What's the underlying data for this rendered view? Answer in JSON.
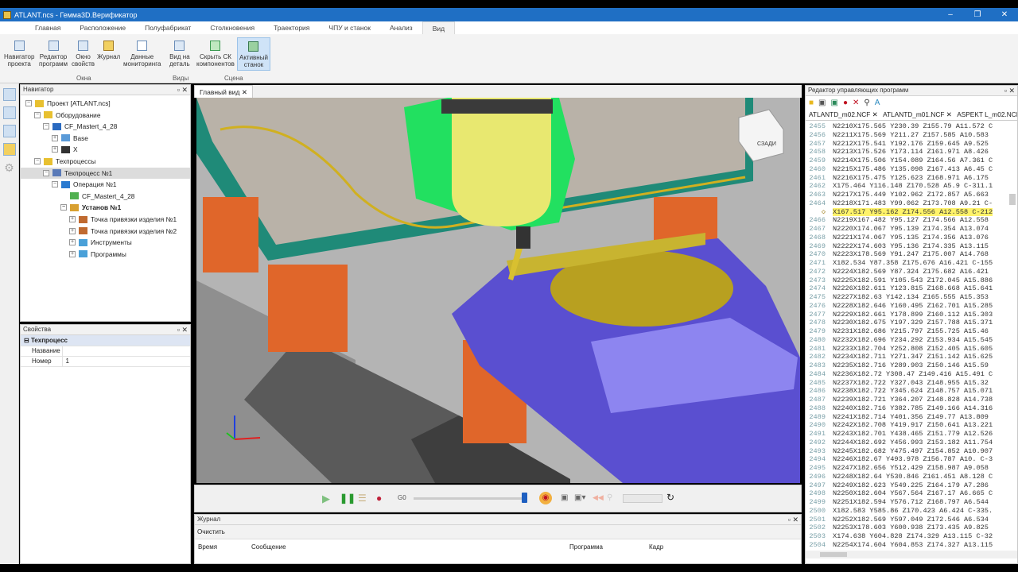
{
  "window": {
    "title": "ATLANT.ncs - Гемма3D.Верификатор",
    "controls": [
      "–",
      "❐",
      "✕"
    ]
  },
  "menu_tabs": [
    "Главная",
    "Расположение",
    "Полуфабрикат",
    "Столкновения",
    "Траектория",
    "ЧПУ и станок",
    "Анализ",
    "Вид"
  ],
  "ribbon": {
    "buttons": [
      {
        "l1": "Навигатор",
        "l2": "проекта"
      },
      {
        "l1": "Редактор",
        "l2": "программ"
      },
      {
        "l1": "Окно",
        "l2": "свойств"
      },
      {
        "l1": "Журнал",
        "l2": ""
      },
      {
        "l1": "Данные",
        "l2": "мониторинга"
      },
      {
        "l1": "Вид на",
        "l2": "деталь"
      },
      {
        "l1": "Скрыть СК",
        "l2": "компонентов"
      },
      {
        "l1": "Активный",
        "l2": "станок"
      }
    ],
    "groups": [
      "Окна",
      "Виды",
      "Сцена"
    ]
  },
  "navigator": {
    "title": "Навигатор",
    "items": [
      {
        "label": "Проект [ATLANT.ncs]",
        "level": 0,
        "exp": "−",
        "icon": "folder"
      },
      {
        "label": "Оборудование",
        "level": 1,
        "exp": "−",
        "icon": "folder"
      },
      {
        "label": "CF_Mastert_4_28",
        "level": 2,
        "exp": "−",
        "icon": "machine"
      },
      {
        "label": "Base",
        "level": 3,
        "exp": "+",
        "icon": "base"
      },
      {
        "label": "X",
        "level": 3,
        "exp": "+",
        "icon": "axis"
      },
      {
        "label": "Техпроцессы",
        "level": 1,
        "exp": "−",
        "icon": "folder"
      },
      {
        "label": "Техпроцесс №1",
        "level": 2,
        "exp": "−",
        "icon": "gears",
        "selected": true
      },
      {
        "label": "Операция №1",
        "level": 3,
        "exp": "−",
        "icon": "gear"
      },
      {
        "label": "CF_Mastert_4_28",
        "level": 4,
        "exp": "",
        "icon": "machine-green"
      },
      {
        "label": "Установ №1",
        "level": 4,
        "exp": "−",
        "icon": "setup",
        "bold": true
      },
      {
        "label": "Точка привязки изделия №1",
        "level": 5,
        "exp": "+",
        "icon": "point"
      },
      {
        "label": "Точка привязки изделия №2",
        "level": 5,
        "exp": "+",
        "icon": "point"
      },
      {
        "label": "Инструменты",
        "level": 5,
        "exp": "+",
        "icon": "bfolder"
      },
      {
        "label": "Программы",
        "level": 5,
        "exp": "+",
        "icon": "bfolder"
      }
    ]
  },
  "properties": {
    "title": "Свойства",
    "section": "Техпроцесс",
    "rows": [
      {
        "name": "Название",
        "value": ""
      },
      {
        "name": "Номер",
        "value": "1"
      }
    ]
  },
  "view": {
    "tab": "Главный вид",
    "cube_label": "СЗАДИ"
  },
  "player": {
    "progress": 1.0
  },
  "journal": {
    "title": "Журнал",
    "clear": "Очистить",
    "columns": [
      "Время",
      "Сообщение",
      "Программа",
      "Кадр"
    ]
  },
  "editor": {
    "title": "Редактор управляющих программ",
    "tabs": [
      "ATLANTD_m02.NCF",
      "ATLANTD_m01.NCF",
      "ASPEKT L_m02.NCF"
    ],
    "first_line": 2455,
    "highlight_index": 10,
    "lines": [
      "N2210X175.565 Y230.39 Z155.79 A11.572 C",
      "N2211X175.569 Y211.27 Z157.585 A10.583",
      "N2212X175.541 Y192.176 Z159.645 A9.525",
      "N2213X175.526 Y173.114 Z161.971 A8.426",
      "N2214X175.506 Y154.089 Z164.56 A7.361 C",
      "N2215X175.486 Y135.098 Z167.413 A6.45 C",
      "N2216X175.475 Y125.623 Z168.971 A6.175",
      "X175.464 Y116.148 Z170.528 A5.9 C-311.1",
      "N2217X175.449 Y102.962 Z172.857 A5.663",
      "N2218X171.483 Y99.062 Z173.708 A9.21 C-",
      "X167.517 Y95.162 Z174.556 A12.558 C-212",
      "N2219X167.482 Y95.127 Z174.566 A12.558",
      "N2220X174.067 Y95.139 Z174.354 A13.074",
      "N2221X174.067 Y95.135 Z174.356 A13.076",
      "N2222X174.603 Y95.136 Z174.335 A13.115",
      "N2223X178.569 Y91.247 Z175.007 A14.768",
      "X182.534 Y87.358 Z175.676 A16.421 C-155",
      "N2224X182.569 Y87.324 Z175.682 A16.421",
      "N2225X182.591 Y105.543 Z172.045 A15.886",
      "N2226X182.611 Y123.815 Z168.668 A15.641",
      "N2227X182.63 Y142.134 Z165.555 A15.353",
      "N2228X182.646 Y160.495 Z162.701 A15.285",
      "N2229X182.661 Y178.899 Z160.112 A15.303",
      "N2230X182.675 Y197.329 Z157.788 A15.371",
      "N2231X182.686 Y215.797 Z155.725 A15.46",
      "N2232X182.696 Y234.292 Z153.934 A15.545",
      "N2233X182.704 Y252.808 Z152.405 A15.605",
      "N2234X182.711 Y271.347 Z151.142 A15.625",
      "N2235X182.716 Y289.903 Z150.146 A15.59",
      "N2236X182.72 Y308.47 Z149.416 A15.491 C",
      "N2237X182.722 Y327.043 Z148.955 A15.32",
      "N2238X182.722 Y345.624 Z148.757 A15.071",
      "N2239X182.721 Y364.207 Z148.828 A14.738",
      "N2240X182.716 Y382.785 Z149.166 A14.316",
      "N2241X182.714 Y401.356 Z149.77 A13.809",
      "N2242X182.708 Y419.917 Z150.641 A13.221",
      "N2243X182.701 Y438.465 Z151.779 A12.526",
      "N2244X182.692 Y456.993 Z153.182 A11.754",
      "N2245X182.682 Y475.497 Z154.852 A10.907",
      "N2246X182.67 Y493.978 Z156.787 A10. C-3",
      "N2247X182.656 Y512.429 Z158.987 A9.058",
      "N2248X182.64 Y530.846 Z161.451 A8.128 C",
      "N2249X182.623 Y549.225 Z164.179 A7.286",
      "N2250X182.604 Y567.564 Z167.17 A6.665 C",
      "N2251X182.594 Y576.712 Z168.797 A6.544",
      "X182.583 Y585.86 Z170.423 A6.424 C-335.",
      "N2252X182.569 Y597.049 Z172.546 A6.534",
      "N2253X178.603 Y600.938 Z173.435 A9.825",
      "X174.638 Y604.828 Z174.329 A13.115 C-32",
      "N2254X174.604 Y604.853 Z174.327 A13.115"
    ]
  },
  "colors": {
    "titlebar": "#1f6fc4",
    "highlight": "#fff36a",
    "slab": "#1f8a78",
    "support": "#e0662a",
    "block": "#5a4fd0",
    "spindle": "#e8e870",
    "head": "#22e060"
  }
}
